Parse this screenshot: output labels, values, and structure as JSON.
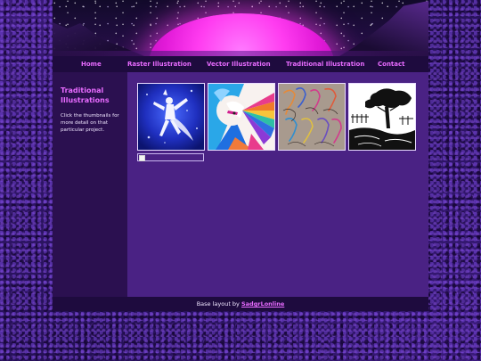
{
  "nav": {
    "items": [
      {
        "label": "Home"
      },
      {
        "label": "Raster Illustration"
      },
      {
        "label": "Vector Illustration"
      },
      {
        "label": "Traditional Illustration"
      },
      {
        "label": "Contact"
      }
    ]
  },
  "sidebar": {
    "title": "Traditional Illustrations",
    "description": "Click the thumbnails for more detail on that particular project."
  },
  "gallery": {
    "thumbnails": [
      {
        "subject": "dancing-figure-blue"
      },
      {
        "subject": "fan-character"
      },
      {
        "subject": "horses-sketch"
      },
      {
        "subject": "tree-landscape-ink"
      }
    ]
  },
  "footer": {
    "prefix": "Base layout by",
    "link": "SadgrLonline"
  },
  "colors": {
    "accent": "#e86bff",
    "nav_bg": "#1e0b3e",
    "sidebar_bg": "#2b1050",
    "content_bg": "#4a2284"
  }
}
